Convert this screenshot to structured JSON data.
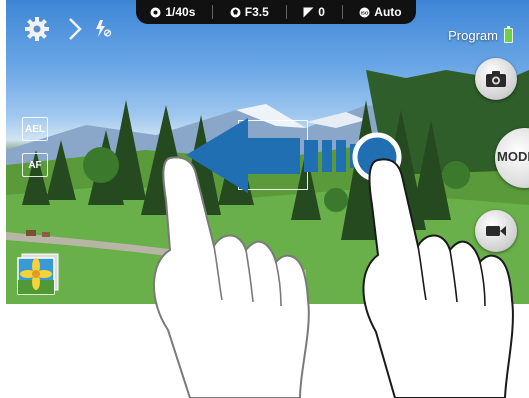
{
  "status_bar": {
    "shutter": "1/40s",
    "aperture": "F3.5",
    "exposure": "0",
    "iso": "Auto"
  },
  "mode_label": "Program",
  "battery_level": 0.85,
  "left_indicators": [
    "AEL",
    "AF"
  ],
  "mode_button_label": "MODE",
  "icons": [
    "settings-gear-icon",
    "chevron-right-icon",
    "flash-off-icon",
    "camera-icon",
    "video-camera-icon",
    "gallery-thumbnail",
    "swipe-left-arrow"
  ]
}
